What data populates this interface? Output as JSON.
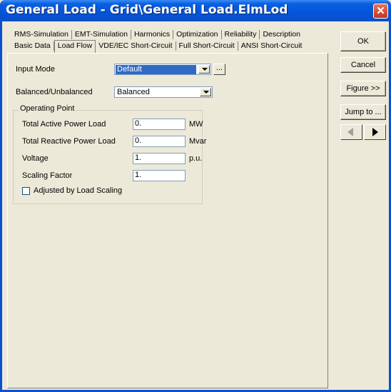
{
  "window": {
    "title": "General Load - Grid\\General Load.ElmLod",
    "close_glyph": "✕"
  },
  "tabs": {
    "row1": [
      "RMS-Simulation",
      "EMT-Simulation",
      "Harmonics",
      "Optimization",
      "Reliability",
      "Description"
    ],
    "row2": [
      "Basic Data",
      "Load Flow",
      "VDE/IEC Short-Circuit",
      "Full Short-Circuit",
      "ANSI Short-Circuit"
    ],
    "active": "Load Flow"
  },
  "form": {
    "input_mode_label": "Input Mode",
    "input_mode_value": "Default",
    "ellipsis": "...",
    "balanced_label": "Balanced/Unbalanced",
    "balanced_value": "Balanced",
    "operating_point": {
      "title": "Operating Point",
      "fields": [
        {
          "label": "Total Active Power Load",
          "value": "0.",
          "unit": "MW"
        },
        {
          "label": "Total Reactive Power Load",
          "value": "0.",
          "unit": "Mvar"
        },
        {
          "label": "Voltage",
          "value": "1.",
          "unit": "p.u."
        },
        {
          "label": "Scaling Factor",
          "value": "1.",
          "unit": ""
        }
      ],
      "checkbox_label": "Adjusted by Load Scaling",
      "checkbox_checked": false
    }
  },
  "buttons": {
    "ok": "OK",
    "cancel": "Cancel",
    "figure": "Figure >>",
    "jump": "Jump to ..."
  },
  "icons": {
    "nav_prev": "triangle-left-icon",
    "nav_next": "triangle-right-icon"
  }
}
